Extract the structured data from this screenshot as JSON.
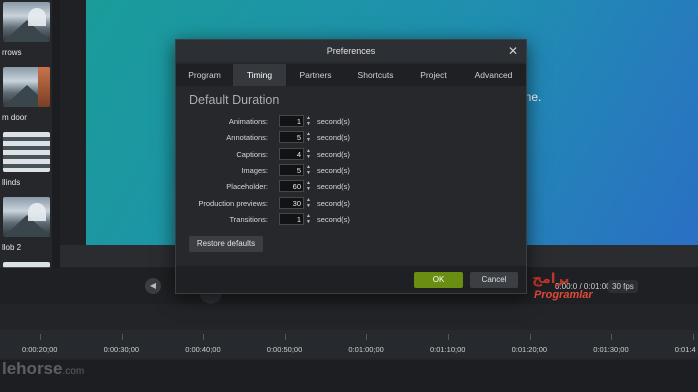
{
  "media_bin": {
    "labels": [
      "rrows",
      "m door",
      "llinds",
      "llob 2"
    ]
  },
  "canvas": {
    "text_fragment": "ine."
  },
  "playback": {
    "timecode": "0:00:0 / 0:01:00",
    "fps": "30 fps"
  },
  "timeline": {
    "ticks": [
      "0:00:20;00",
      "0:00:30;00",
      "0:00:40;00",
      "0:00:50;00",
      "0:01:00;00",
      "0:01:10;00",
      "0:01:20;00",
      "0:01:30;00",
      "0:01:4"
    ]
  },
  "watermarks": {
    "programlar": "Programlar",
    "arabic": "برامج",
    "filehorse": "lehorse",
    "filehorse_suffix": ".com"
  },
  "dialog": {
    "title": "Preferences",
    "tabs": [
      "Program",
      "Timing",
      "Partners",
      "Shortcuts",
      "Project",
      "Advanced"
    ],
    "active_tab": "Timing",
    "section_title": "Default Duration",
    "unit": "second(s)",
    "rows": [
      {
        "label": "Animations:",
        "value": "1"
      },
      {
        "label": "Annotations:",
        "value": "5"
      },
      {
        "label": "Captions:",
        "value": "4"
      },
      {
        "label": "Images:",
        "value": "5"
      },
      {
        "label": "Placeholder:",
        "value": "60"
      },
      {
        "label": "Production previews:",
        "value": "30"
      },
      {
        "label": "Transitions:",
        "value": "1"
      }
    ],
    "restore_label": "Restore defaults",
    "ok_label": "OK",
    "cancel_label": "Cancel"
  },
  "colors": {
    "accent_ok": "#6a8e12",
    "canvas_start": "#1a9c9a",
    "canvas_end": "#2a6fc4"
  }
}
